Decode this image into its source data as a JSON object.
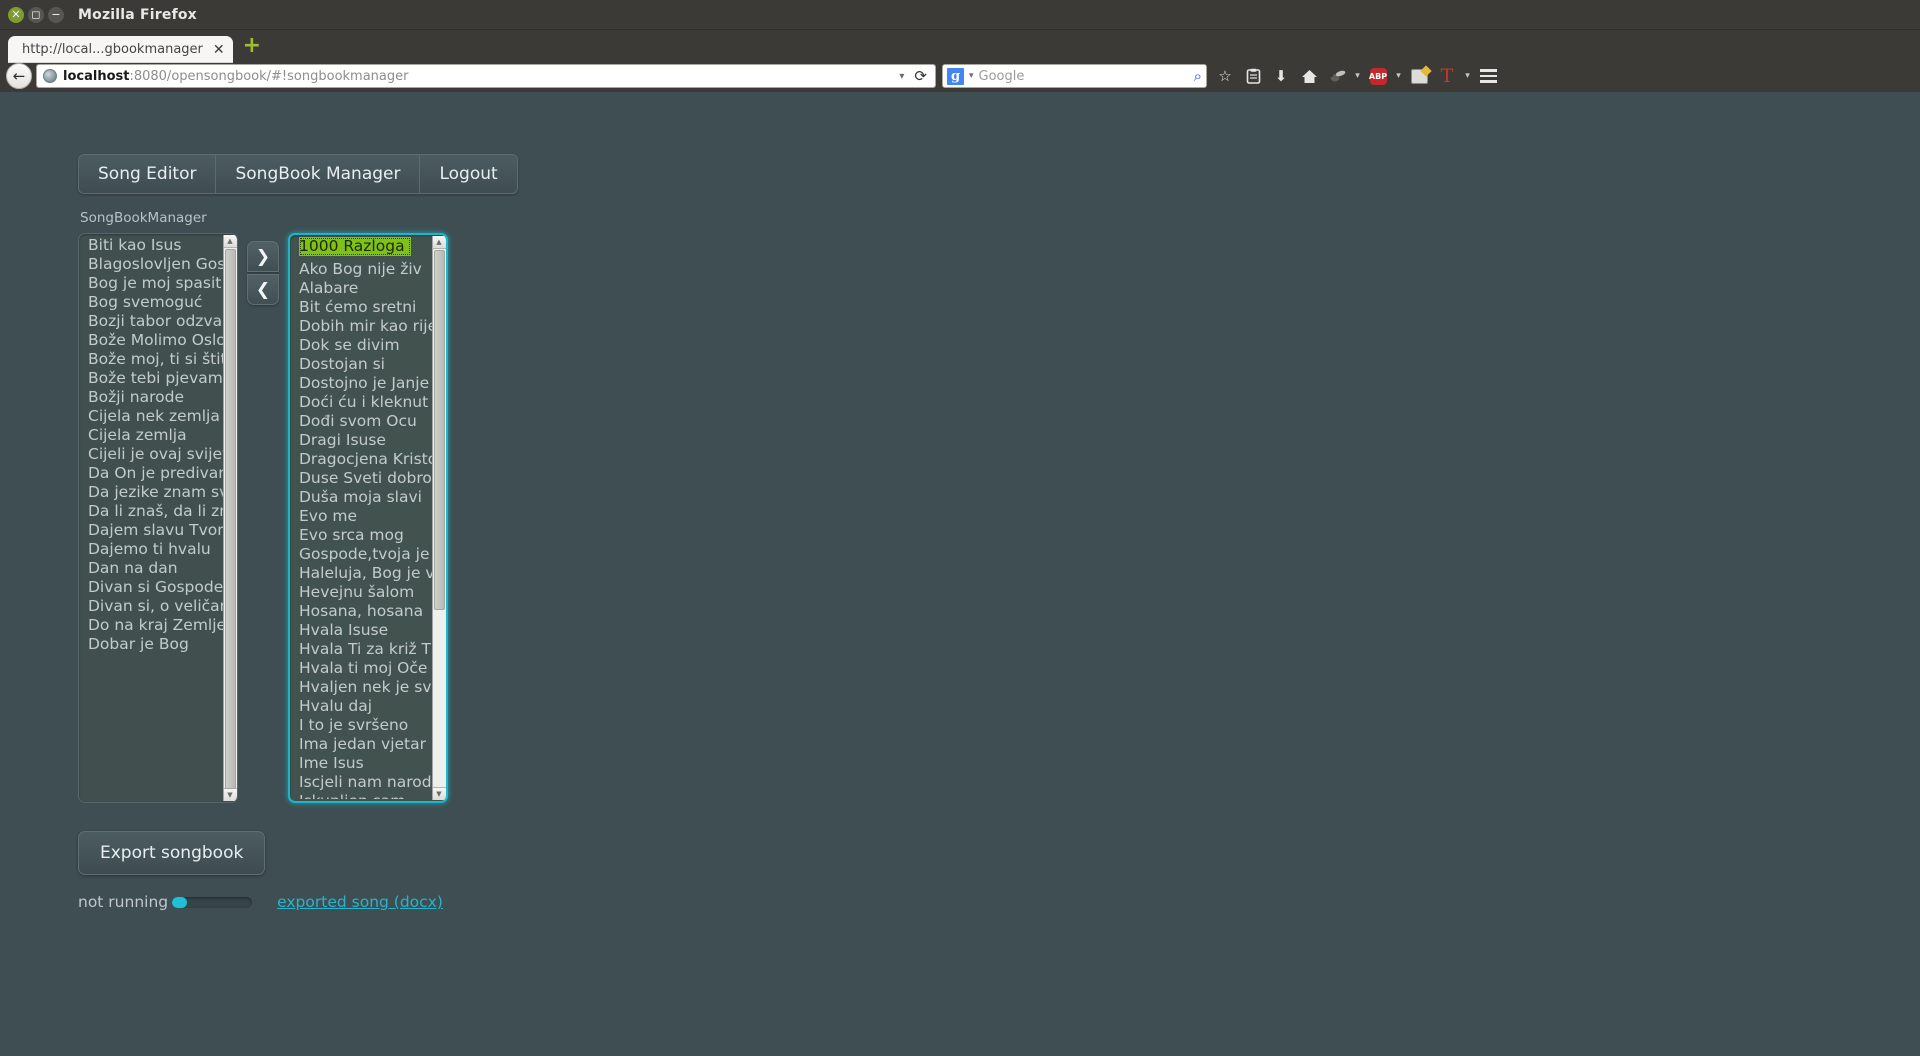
{
  "window": {
    "title": "Mozilla Firefox",
    "close_icon": "close-icon",
    "maximize_icon": "maximize-icon",
    "minimize_icon": "minimize-icon"
  },
  "tabbar": {
    "tabs": [
      {
        "label": "http://local...gbookmanager",
        "close_label": "✕"
      }
    ],
    "new_tab_label": "+"
  },
  "navbar": {
    "back_label": "←",
    "url_prefix": "localhost",
    "url_suffix": ":8080/opensongbook/#!songbookmanager",
    "url_full": "localhost:8080/opensongbook/#!songbookmanager",
    "dropdown_caret": "▾",
    "reload_label": "⟳",
    "search_engine": "Google",
    "search_engine_letter": "g",
    "search_caret": "▾",
    "search_go": "⌕",
    "icons": [
      {
        "name": "bookmark-star-icon",
        "glyph": "☆"
      },
      {
        "name": "reader-list-icon",
        "glyph": "☰"
      },
      {
        "name": "downloads-icon",
        "glyph": "⬇"
      },
      {
        "name": "home-icon",
        "glyph": "⌂"
      },
      {
        "name": "firebug-icon",
        "glyph": "🐞"
      },
      {
        "name": "adblock-plus-icon",
        "glyph": "ABP"
      },
      {
        "name": "selenium-ide-icon",
        "glyph": "Se"
      },
      {
        "name": "tampermonkey-t-icon",
        "glyph": "T"
      },
      {
        "name": "menu-hamburger-icon",
        "glyph": "≡"
      }
    ]
  },
  "app": {
    "nav_tabs": [
      {
        "label": "Song Editor"
      },
      {
        "label": "SongBook Manager"
      },
      {
        "label": "Logout"
      }
    ],
    "section_label": "SongBookManager",
    "available_songs": [
      "Biti kao Isus",
      "Blagoslovljen Gos",
      "Bog je moj spasit",
      "Bog svemoguć",
      "Bozji tabor odzva",
      "Bože Molimo Oslo",
      "Bože moj, ti si štit",
      "Bože tebi pjevam",
      "Božji narode",
      "Cijela nek zemlja",
      "Cijela zemlja",
      "Cijeli je ovaj svijet",
      "Da On je predivan",
      "Da jezike znam sv",
      "Da li znaš, da li zn",
      "Dajem slavu Tvom",
      "Dajemo ti hvalu",
      "Dan na dan",
      "Divan si Gospode",
      "Divan si, o veličan",
      "Do na kraj Zemlje",
      "Dobar je Bog"
    ],
    "selected_songs": [
      "1000 Razloga",
      "Ako Bog nije živ",
      "Alabare",
      "Bit ćemo sretni",
      "Dobih mir kao rije",
      "Dok se divim",
      "Dostojan si",
      "Dostojno je Janje",
      "Doći ću i kleknut",
      "Dođi svom Ocu",
      "Dragi Isuse",
      "Dragocjena Kristo",
      "Duse Sveti dobro",
      "Duša moja slavi",
      "Evo me",
      "Evo srca mog",
      "Gospode,tvoja je",
      "Haleluja, Bog je v",
      "Hevejnu šalom",
      "Hosana, hosana",
      "Hvala Isuse",
      "Hvala Ti za križ T",
      "Hvala ti moj Oče",
      "Hvaljen nek je sve",
      "Hvalu daj",
      "I to je svršeno",
      "Ima jedan vjetar",
      "Ime Isus",
      "Iscjeli nam narod",
      "Iskupljen sam"
    ],
    "selected_song_index": 0,
    "move_right_label": "❯",
    "move_left_label": "❮",
    "scroll_up_label": "▲",
    "scroll_down_label": "▼",
    "export_button_label": "Export songbook",
    "status_text": "not running",
    "progress_percent": 18,
    "export_link_label": "exported song (docx)"
  },
  "colors": {
    "accent_cyan": "#1bb6c9",
    "selection_green": "#7fc11a",
    "page_bg": "#3e4e52",
    "chrome_bg": "#3b3a36",
    "link_cyan": "#27b5cc"
  }
}
